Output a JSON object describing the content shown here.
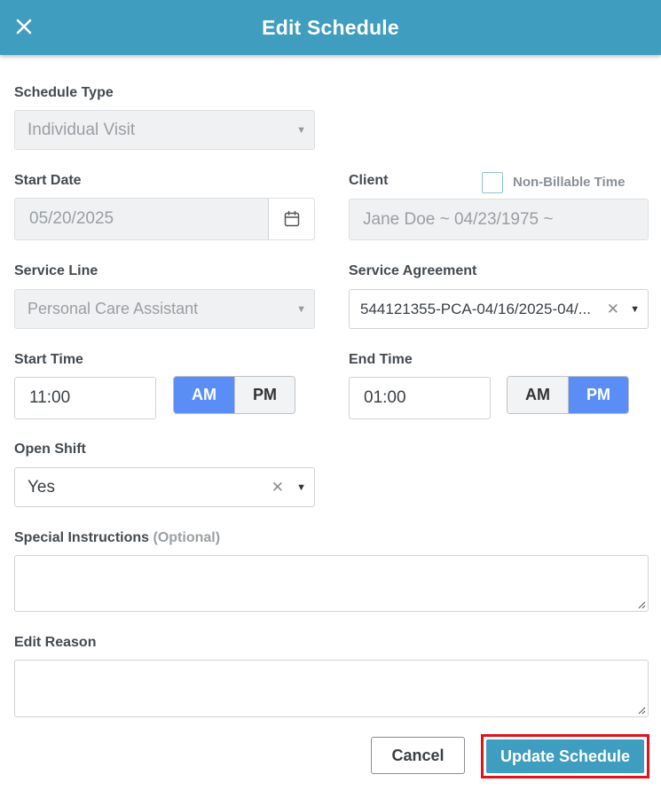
{
  "header": {
    "title": "Edit Schedule",
    "close_icon": "close-icon"
  },
  "schedule_type": {
    "label": "Schedule Type",
    "value": "Individual Visit"
  },
  "start_date": {
    "label": "Start Date",
    "value": "05/20/2025",
    "icon": "calendar-icon"
  },
  "client": {
    "label": "Client",
    "value": "Jane Doe ~ 04/23/1975 ~",
    "non_billable_label": "Non-Billable Time",
    "non_billable_checked": false
  },
  "service_line": {
    "label": "Service Line",
    "value": "Personal Care Assistant"
  },
  "service_agreement": {
    "label": "Service Agreement",
    "value": "544121355-PCA-04/16/2025-04/..."
  },
  "start_time": {
    "label": "Start Time",
    "value": "11:00",
    "am": "AM",
    "pm": "PM",
    "selected": "AM"
  },
  "end_time": {
    "label": "End Time",
    "value": "01:00",
    "am": "AM",
    "pm": "PM",
    "selected": "PM"
  },
  "open_shift": {
    "label": "Open Shift",
    "value": "Yes"
  },
  "special_instructions": {
    "label": "Special Instructions",
    "optional": "(Optional)",
    "value": ""
  },
  "edit_reason": {
    "label": "Edit Reason",
    "value": ""
  },
  "actions": {
    "cancel": "Cancel",
    "update": "Update Schedule"
  },
  "colors": {
    "header": "#3f9dc0",
    "toggle_active": "#5a8ef6",
    "highlight": "#e0121a"
  }
}
